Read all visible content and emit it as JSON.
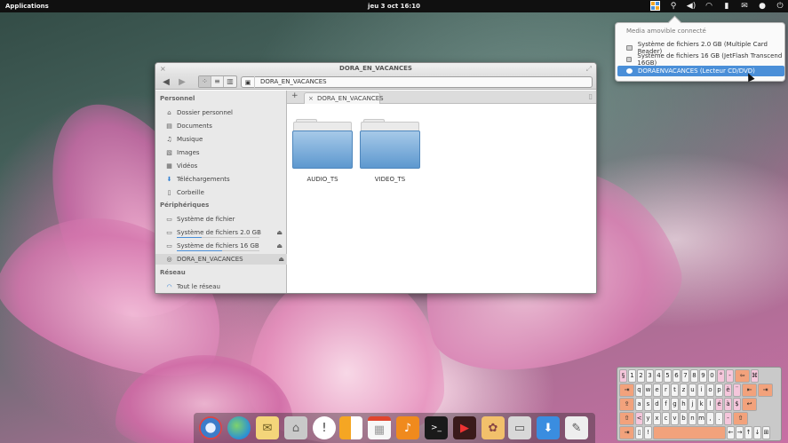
{
  "panel": {
    "applications_label": "Applications",
    "clock": "jeu  3 oct 16:10",
    "indicators": [
      "media-indicator-icon",
      "usb-icon",
      "volume-icon",
      "wifi-icon",
      "battery-icon",
      "mail-icon",
      "user-icon",
      "power-icon"
    ]
  },
  "popover": {
    "title": "Media amovible connecté",
    "items": [
      "Système de fichiers 2.0 GB (Multiple Card  Reader)",
      "Système de fichiers 16 GB (JetFlash Transcend 16GB)",
      "DORAENVACANCES (Lecteur CD/DVD)"
    ],
    "selected_index": 2
  },
  "window": {
    "title": "DORA_EN_VACANCES",
    "location_crumb": "DORA_EN_VACANCES",
    "tab_label": "DORA_EN_VACANCES",
    "sidebar": {
      "section_personal": "Personnel",
      "personal_items": [
        "Dossier personnel",
        "Documents",
        "Musique",
        "Images",
        "Vidéos",
        "Téléchargements",
        "Corbeille"
      ],
      "section_devices": "Périphériques",
      "device_items": [
        "Système de fichier",
        "Système de fichiers 2.0 GB",
        "Système de fichiers 16 GB",
        "DORA_EN_VACANCES"
      ],
      "device_usage": [
        0,
        0.3,
        0.55,
        0
      ],
      "section_network": "Réseau",
      "network_items": [
        "Tout le réseau"
      ]
    },
    "folders": [
      "AUDIO_TS",
      "VIDEO_TS"
    ]
  },
  "dock": {
    "icons": [
      "browser-icon",
      "globe-icon",
      "mail-app-icon",
      "files-icon",
      "chat-icon",
      "apps-icon",
      "calendar-icon",
      "music-icon",
      "terminal-icon",
      "video-icon",
      "photos-icon",
      "switch-icon",
      "download-icon",
      "editor-icon"
    ]
  },
  "keyboard": {
    "row1": [
      "§",
      "1",
      "2",
      "3",
      "4",
      "5",
      "6",
      "7",
      "8",
      "9",
      "0",
      "°",
      "-",
      "⇦",
      "⌘"
    ],
    "row2": [
      "⇥",
      "q",
      "w",
      "e",
      "r",
      "t",
      "z",
      "u",
      "i",
      "o",
      "p",
      "è",
      "¨",
      "⇤",
      "⇥"
    ],
    "row3": [
      "⇪",
      "a",
      "s",
      "d",
      "f",
      "g",
      "h",
      "j",
      "k",
      "l",
      "é",
      "à",
      "$",
      "↩"
    ],
    "row4": [
      "⇧",
      "<",
      "y",
      "x",
      "c",
      "v",
      "b",
      "n",
      "m",
      ",",
      ".",
      "-",
      "⇧"
    ],
    "row5": [
      "⇥",
      "▯",
      "!",
      "",
      "←",
      "→",
      "↑",
      "↓",
      "⊞"
    ]
  }
}
